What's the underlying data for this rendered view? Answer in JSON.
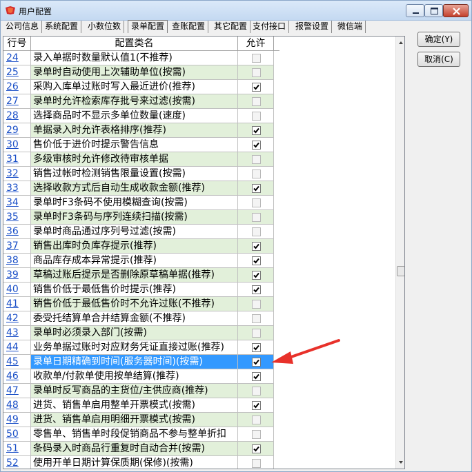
{
  "window": {
    "title": "用户配置"
  },
  "tabs": [
    {
      "label": "公司信息"
    },
    {
      "label": "系统配置"
    },
    {
      "label": "小数位数"
    },
    {
      "label": "录单配置"
    },
    {
      "label": "查账配置"
    },
    {
      "label": "其它配置"
    },
    {
      "label": "支付接口"
    },
    {
      "label": "报警设置"
    },
    {
      "label": "微信端"
    }
  ],
  "active_tab": "录单配置",
  "table": {
    "headers": {
      "no": "行号",
      "name": "配置类名",
      "allow": "允许"
    },
    "rows": [
      {
        "no": "24",
        "name": "录入单据时数量默认值1(不推荐)",
        "checked": false,
        "shade": "white"
      },
      {
        "no": "25",
        "name": "录单时自动使用上次辅助单位(按需)",
        "checked": false,
        "shade": "green"
      },
      {
        "no": "26",
        "name": "采购入库单过账时写入最近进价(推荐)",
        "checked": true,
        "shade": "white"
      },
      {
        "no": "27",
        "name": "录单时允许检索库存批号来过滤(按需)",
        "checked": false,
        "shade": "green"
      },
      {
        "no": "28",
        "name": "选择商品时不显示多单位数量(速度)",
        "checked": false,
        "shade": "white"
      },
      {
        "no": "29",
        "name": "单据录入时允许表格排序(推荐)",
        "checked": true,
        "shade": "green"
      },
      {
        "no": "30",
        "name": "售价低于进价时提示警告信息",
        "checked": true,
        "shade": "white"
      },
      {
        "no": "31",
        "name": "多级审核时允许修改待审核单据",
        "checked": false,
        "shade": "green"
      },
      {
        "no": "32",
        "name": "销售过帐时检测销售限量设置(按需)",
        "checked": false,
        "shade": "white"
      },
      {
        "no": "33",
        "name": "选择收款方式后自动生成收款金额(推荐)",
        "checked": true,
        "shade": "green"
      },
      {
        "no": "34",
        "name": "录单时F3条码不使用模糊查询(按需)",
        "checked": false,
        "shade": "white"
      },
      {
        "no": "35",
        "name": "录单时F3条码与序列连续扫描(按需)",
        "checked": false,
        "shade": "green"
      },
      {
        "no": "36",
        "name": "录单时商品通过序列号过滤(按需)",
        "checked": false,
        "shade": "white"
      },
      {
        "no": "37",
        "name": "销售出库时负库存提示(推荐)",
        "checked": true,
        "shade": "green"
      },
      {
        "no": "38",
        "name": "商品库存成本异常提示(推荐)",
        "checked": true,
        "shade": "white"
      },
      {
        "no": "39",
        "name": "草稿过账后提示是否删除原草稿单据(推荐)",
        "checked": true,
        "shade": "green"
      },
      {
        "no": "40",
        "name": "销售价低于最低售价时提示(推荐)",
        "checked": true,
        "shade": "white"
      },
      {
        "no": "41",
        "name": "销售价低于最低售价时不允许过账(不推荐)",
        "checked": false,
        "shade": "green"
      },
      {
        "no": "42",
        "name": "委受托结算单合并结算金额(不推荐)",
        "checked": false,
        "shade": "white"
      },
      {
        "no": "43",
        "name": "录单时必须录入部门(按需)",
        "checked": false,
        "shade": "green"
      },
      {
        "no": "44",
        "name": "业务单据过账时对应财务凭证直接过账(推荐)",
        "checked": true,
        "shade": "white"
      },
      {
        "no": "45",
        "name": "录单日期精确到时间(服务器时间)(按需)",
        "checked": true,
        "shade": "sel"
      },
      {
        "no": "46",
        "name": "收款单/付款单使用按单结算(推荐)",
        "checked": true,
        "shade": "white"
      },
      {
        "no": "47",
        "name": "录单时反写商品的主货位/主供应商(推荐)",
        "checked": false,
        "shade": "green"
      },
      {
        "no": "48",
        "name": "进货、销售单启用整单开票模式(按需)",
        "checked": true,
        "shade": "white"
      },
      {
        "no": "49",
        "name": "进货、销售单启用明细开票模式(按需)",
        "checked": false,
        "shade": "green"
      },
      {
        "no": "50",
        "name": "零售单、销售单时段促销商品不参与整单折扣",
        "checked": false,
        "shade": "white"
      },
      {
        "no": "51",
        "name": "条码录入时商品行重复时自动合并(按需)",
        "checked": true,
        "shade": "green"
      },
      {
        "no": "52",
        "name": "使用开单日期计算保质期(保修)(按需)",
        "checked": false,
        "shade": "white"
      }
    ]
  },
  "buttons": {
    "ok": "确定(Y)",
    "cancel": "取消(C)"
  },
  "colors": {
    "selected_row": "#3399ff",
    "green_row": "#e2f0da",
    "annotation_arrow": "#e8312a"
  }
}
